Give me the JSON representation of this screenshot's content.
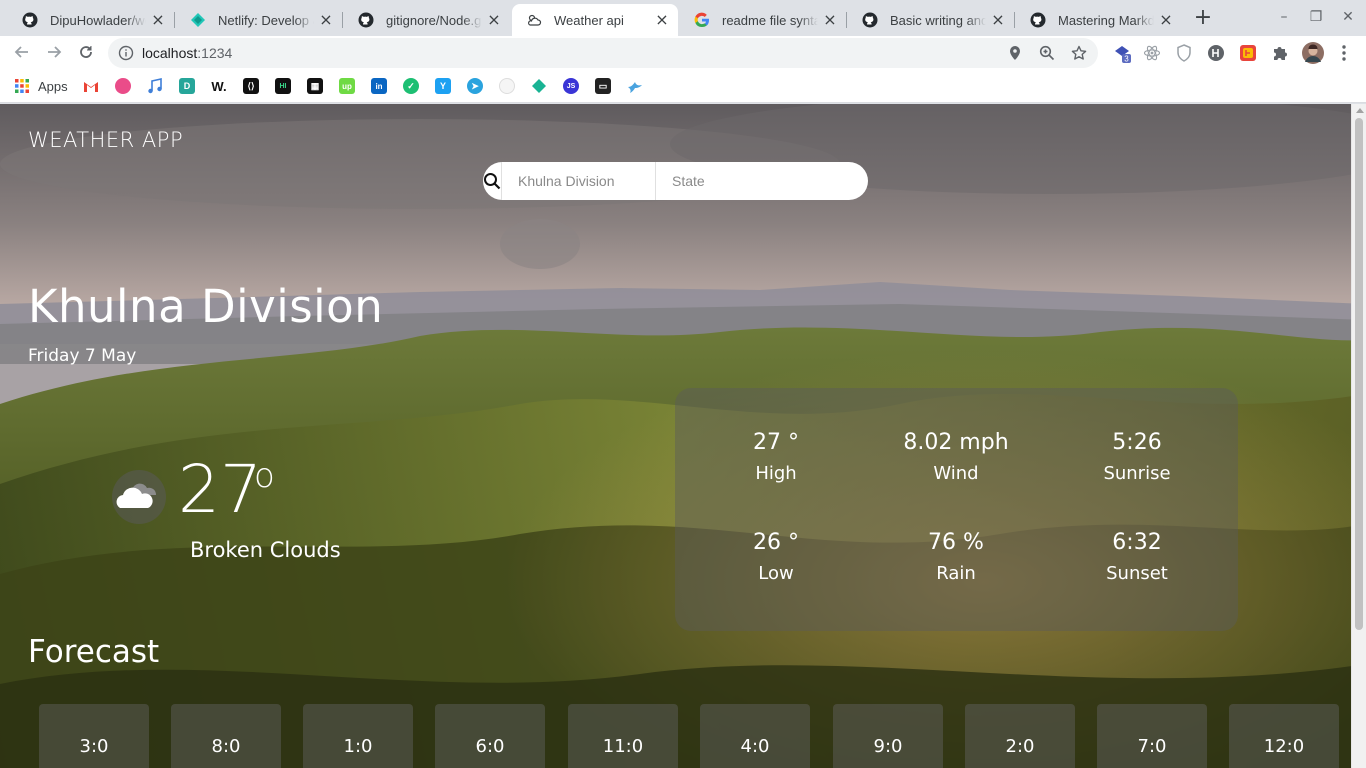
{
  "browser": {
    "tabs": [
      {
        "title": "DipuHowlader/we",
        "icon": "github-icon"
      },
      {
        "title": "Netlify: Develop &",
        "icon": "netlify-icon"
      },
      {
        "title": "gitignore/Node.git",
        "icon": "github-icon"
      },
      {
        "title": "Weather api",
        "icon": "weather-icon",
        "active": true
      },
      {
        "title": "readme file syntax",
        "icon": "google-icon"
      },
      {
        "title": "Basic writing and f",
        "icon": "github-icon"
      },
      {
        "title": "Mastering Markdo",
        "icon": "github-icon"
      }
    ],
    "new_tab": "+",
    "window_controls": {
      "minimize": "–",
      "restore": "❐",
      "close": "✕"
    },
    "url_host": "localhost",
    "url_port": ":1234",
    "extension_badge": "3",
    "bookmarks_apps_label": "Apps"
  },
  "app": {
    "brand": "WEATHER APP",
    "search": {
      "city_placeholder": "Khulna Division",
      "state_placeholder": "State"
    },
    "location": "Khulna Division",
    "date": "Friday 7 May",
    "temperature": "27",
    "degree_symbol": "o",
    "condition": "Broken Clouds",
    "stats": {
      "high_value": "27 °",
      "high_label": "High",
      "wind_value": "8.02 mph",
      "wind_label": "Wind",
      "sunrise_value": "5:26",
      "sunrise_label": "Sunrise",
      "low_value": "26 °",
      "low_label": "Low",
      "rain_value": "76 %",
      "rain_label": "Rain",
      "sunset_value": "6:32",
      "sunset_label": "Sunset"
    },
    "forecast_title": "Forecast",
    "forecast": [
      "3:0",
      "8:0",
      "1:0",
      "6:0",
      "11:0",
      "4:0",
      "9:0",
      "2:0",
      "7:0",
      "12:0"
    ]
  }
}
